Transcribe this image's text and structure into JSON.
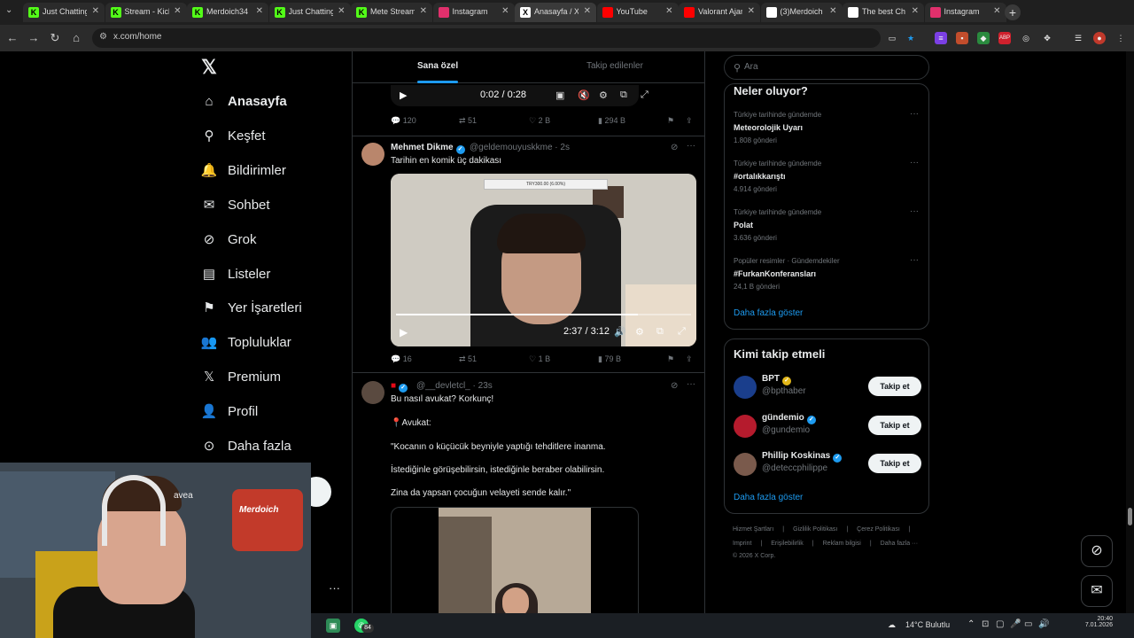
{
  "browser": {
    "tabs": [
      {
        "label": "Just Chatting",
        "icon": "kick-icon",
        "favcolor": "#53fc18"
      },
      {
        "label": "Stream - Kick",
        "icon": "kick-icon",
        "favcolor": "#53fc18"
      },
      {
        "label": "Merdoich34",
        "icon": "kick-icon",
        "favcolor": "#53fc18"
      },
      {
        "label": "Just Chatting",
        "icon": "kick-icon",
        "favcolor": "#53fc18"
      },
      {
        "label": "Mete Stream",
        "icon": "kick-icon",
        "favcolor": "#53fc18"
      },
      {
        "label": "Instagram",
        "icon": "instagram-icon",
        "favcolor": "#e1306c"
      },
      {
        "label": "Anasayfa / X",
        "icon": "x-icon",
        "favcolor": "#ffffff"
      },
      {
        "label": "YouTube",
        "icon": "youtube-icon",
        "favcolor": "#ff0000"
      },
      {
        "label": "Valorant Ajan",
        "icon": "youtube-icon",
        "favcolor": "#ff0000"
      },
      {
        "label": "(3)Merdoich",
        "icon": "tiktok-icon",
        "favcolor": "#ffffff"
      },
      {
        "label": "The best Ch",
        "icon": "chatgpt-icon",
        "favcolor": "#ffffff"
      },
      {
        "label": "Instagram",
        "icon": "instagram-icon",
        "favcolor": "#e1306c"
      }
    ],
    "url": "x.com/home"
  },
  "sidebar": {
    "items": [
      {
        "label": "Anasayfa",
        "icon": "home-icon"
      },
      {
        "label": "Keşfet",
        "icon": "search-icon"
      },
      {
        "label": "Bildirimler",
        "icon": "bell-icon"
      },
      {
        "label": "Sohbet",
        "icon": "mail-icon"
      },
      {
        "label": "Grok",
        "icon": "grok-icon"
      },
      {
        "label": "Listeler",
        "icon": "list-icon"
      },
      {
        "label": "Yer İşaretleri",
        "icon": "bookmark-icon"
      },
      {
        "label": "Topluluklar",
        "icon": "communities-icon"
      },
      {
        "label": "Premium",
        "icon": "x-icon"
      },
      {
        "label": "Profil",
        "icon": "profile-icon"
      },
      {
        "label": "Daha fazla",
        "icon": "more-circle-icon"
      }
    ]
  },
  "webcam": {
    "headset_brand": "avea",
    "neon_text": "Merdoich"
  },
  "feed": {
    "tabs": [
      "Sana özel",
      "Takip edilenler"
    ],
    "first_video": {
      "time": "0:02 / 0:28"
    },
    "first_actions": {
      "replies": "120",
      "reposts": "51",
      "likes": "2 B",
      "views": "294 B"
    },
    "tweet2": {
      "name": "Mehmet Dikme",
      "handle": "@geldemouyuskkme · 2s",
      "text": "Tarihin en komik üç dakikası",
      "video_time": "2:37 / 3:12",
      "donation": "TRY300.00 (6.00%)",
      "actions": {
        "replies": "16",
        "reposts": "51",
        "likes": "1 B",
        "views": "79 B"
      }
    },
    "tweet3": {
      "handle": "@__devletcl_ · 23s",
      "lines": [
        "Bu nasıl avukat? Korkunç!",
        "📍Avukat:",
        "\"Kocanın o küçücük beyniyle yaptığı tehditlere inanma.",
        "İstediğinle görüşebilirsin, istediğinle beraber olabilirsin.",
        "Zina da yapsan çocuğun velayeti sende kalır.\""
      ]
    }
  },
  "right": {
    "search_placeholder": "Ara",
    "trends_title": "Neler oluyor?",
    "trends": [
      {
        "context": "Türkiye tarihinde gündemde",
        "name": "Meteorolojik Uyarı",
        "count": "1.808 gönderi"
      },
      {
        "context": "Türkiye tarihinde gündemde",
        "name": "#ortalıkkarıştı",
        "count": "4.914 gönderi"
      },
      {
        "context": "Türkiye tarihinde gündemde",
        "name": "Polat",
        "count": "3.636 gönderi"
      },
      {
        "context": "Popüler resimler · Gündemdekiler",
        "name": "#FurkanKonferansları",
        "count": "24,1 B gönderi"
      }
    ],
    "trends_more": "Daha fazla göster",
    "who_title": "Kimi takip etmeli",
    "who": [
      {
        "name": "BPT",
        "handle": "@bpthaber",
        "badge_color": "#e2b719",
        "avatar_color": "#1a3e8c"
      },
      {
        "name": "gündemio",
        "handle": "@gundemio",
        "badge_color": "#1d9bf0",
        "avatar_color": "#b51b2d"
      },
      {
        "name": "Phillip Koskinas",
        "handle": "@deteccphilippe",
        "badge_color": "#1d9bf0",
        "avatar_color": "#7a5a4c"
      }
    ],
    "follow_label": "Takip et",
    "who_more": "Daha fazla göster",
    "footer_line1": [
      "Hizmet Şartları",
      "|",
      "Gizlilik Politikası",
      "|",
      "Çerez Politikası",
      "|"
    ],
    "footer_line2": [
      "Imprint",
      "|",
      "Erişilebilirlik",
      "|",
      "Reklam bilgisi",
      "|",
      "Daha fazla ···"
    ],
    "copyright": "© 2026 X Corp."
  },
  "taskbar": {
    "whatsapp_badge": "84",
    "weather_temp": "14°C",
    "weather_text": "Bulutlu",
    "time": "20:40",
    "date": "7.01.2026"
  },
  "colors": {
    "accent": "#1d9bf0",
    "bg": "#000000",
    "border": "#2f3336"
  }
}
